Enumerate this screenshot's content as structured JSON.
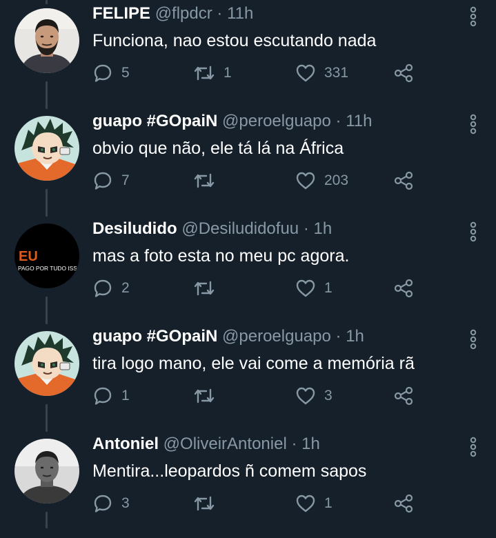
{
  "theme": {
    "background": "#15202b",
    "secondary_text": "#8899a6",
    "thread_line": "#38444d",
    "primary_text": "#ffffff"
  },
  "tweets": [
    {
      "name": "FELIPE",
      "handle": "@flpdcr",
      "dot": "·",
      "time": "11h",
      "text": "Funciona, nao estou escutando nada",
      "replies": "5",
      "retweets": "1",
      "likes": "331",
      "avatar": "bearded-man-photo"
    },
    {
      "name": "guapo #GOpaiN",
      "handle": "@peroelguapo",
      "dot": "·",
      "time": "11h",
      "text": "obvio que não, ele tá lá na África",
      "replies": "7",
      "retweets": "",
      "likes": "203",
      "avatar": "anime-character"
    },
    {
      "name": "Desiludido",
      "handle": "@Desiludidofuu",
      "dot": "·",
      "time": "1h",
      "text": "mas a foto esta no meu pc agora.",
      "replies": "2",
      "retweets": "",
      "likes": "1",
      "avatar": "eu-pago-por-tudo-isso-logo",
      "avatar_text": {
        "big": "EU",
        "small": "PAGO POR TUDO ISSO."
      }
    },
    {
      "name": "guapo #GOpaiN",
      "handle": "@peroelguapo",
      "dot": "·",
      "time": "1h",
      "text": "tira logo mano, ele vai come a memória rã",
      "replies": "1",
      "retweets": "",
      "likes": "3",
      "avatar": "anime-character"
    },
    {
      "name": "Antoniel",
      "handle": "@OliveirAntoniel",
      "dot": "·",
      "time": "1h",
      "text": "Mentira...leopardos ñ comem sapos",
      "replies": "3",
      "retweets": "",
      "likes": "1",
      "avatar": "man-bw-photo"
    }
  ]
}
